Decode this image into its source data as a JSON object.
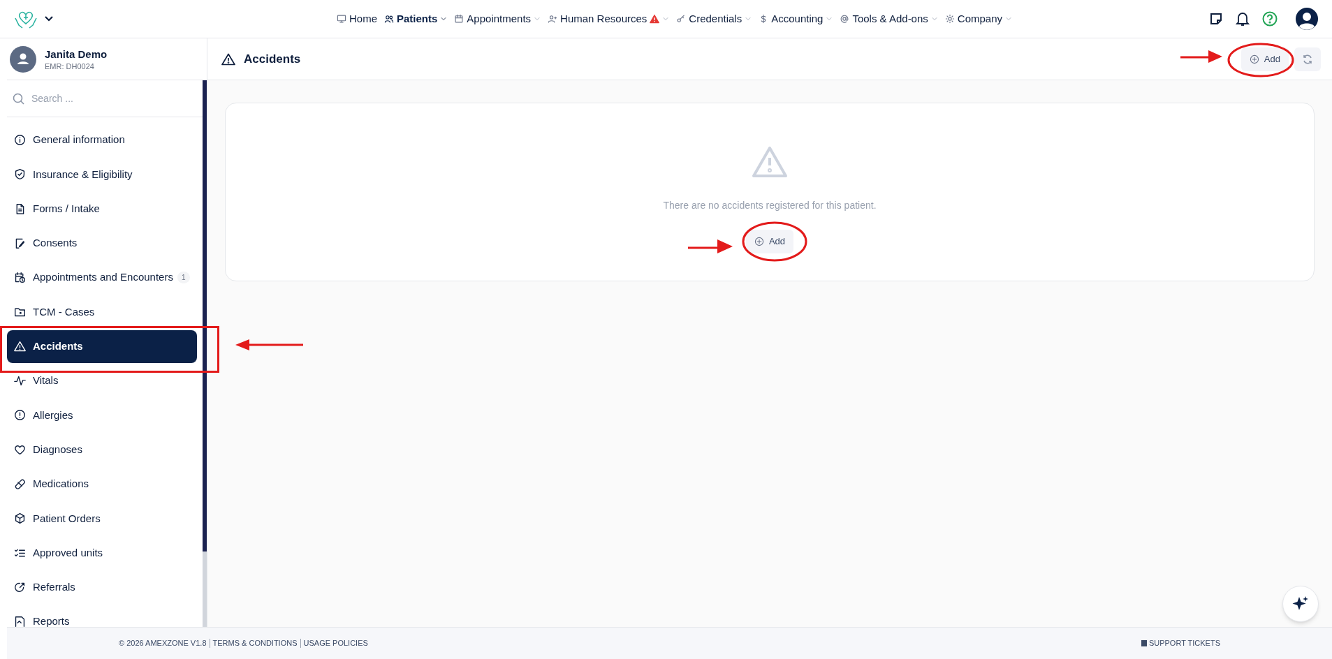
{
  "nav": {
    "items": [
      {
        "label": "Home",
        "dropdown": false,
        "alert": false,
        "selected": false
      },
      {
        "label": "Patients",
        "dropdown": true,
        "alert": false,
        "selected": true
      },
      {
        "label": "Appointments",
        "dropdown": true,
        "alert": false,
        "selected": false
      },
      {
        "label": "Human Resources",
        "dropdown": true,
        "alert": true,
        "selected": false
      },
      {
        "label": "Credentials",
        "dropdown": true,
        "alert": false,
        "selected": false
      },
      {
        "label": "Accounting",
        "dropdown": true,
        "alert": false,
        "selected": false
      },
      {
        "label": "Tools & Add-ons",
        "dropdown": true,
        "alert": false,
        "selected": false
      },
      {
        "label": "Company",
        "dropdown": true,
        "alert": false,
        "selected": false
      }
    ]
  },
  "patient": {
    "name": "Janita Demo",
    "emr": "EMR: DH0024"
  },
  "sidebar": {
    "search": {
      "placeholder": "Search ..."
    },
    "items": [
      {
        "label": "General information",
        "selected": false
      },
      {
        "label": "Insurance & Eligibility",
        "selected": false
      },
      {
        "label": "Forms / Intake",
        "selected": false
      },
      {
        "label": "Consents",
        "selected": false
      },
      {
        "label": "Appointments and Encounters",
        "badge": "1",
        "selected": false
      },
      {
        "label": "TCM - Cases",
        "selected": false
      },
      {
        "label": "Accidents",
        "selected": true
      },
      {
        "label": "Vitals",
        "selected": false
      },
      {
        "label": "Allergies",
        "selected": false
      },
      {
        "label": "Diagnoses",
        "selected": false
      },
      {
        "label": "Medications",
        "selected": false
      },
      {
        "label": "Patient Orders",
        "selected": false
      },
      {
        "label": "Approved units",
        "selected": false
      },
      {
        "label": "Referrals",
        "selected": false
      },
      {
        "label": "Reports",
        "selected": false
      }
    ]
  },
  "page": {
    "title": "Accidents",
    "add_button": "Add",
    "empty_message": "There are no accidents registered for this patient.",
    "empty_add_button": "Add"
  },
  "footer": {
    "copyright": "© 2026 AMEXZONE V1.8",
    "links": [
      "TERMS & CONDITIONS",
      "USAGE POLICIES"
    ],
    "support": "SUPPORT TICKETS"
  }
}
